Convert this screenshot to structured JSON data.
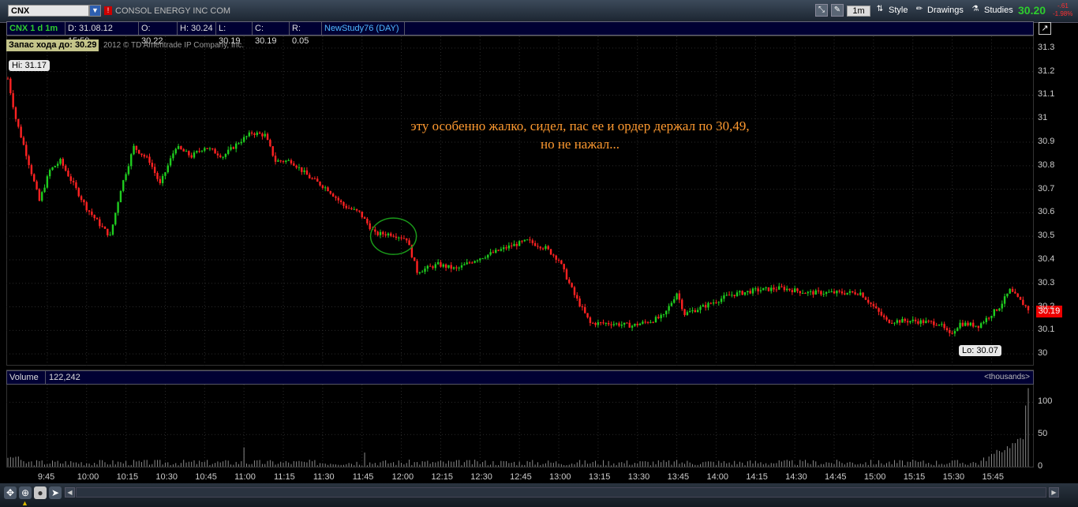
{
  "header": {
    "symbol": "CNX",
    "company_name": "CONSOL ENERGY INC COM",
    "alert_badge": "!",
    "timeframe": "1m",
    "style_label": "Style",
    "drawings_label": "Drawings",
    "studies_label": "Studies",
    "last_price": "30.20",
    "change_abs": "-.61",
    "change_pct": "-1.98%"
  },
  "info_bar": {
    "symbol_period": "CNX 1 d 1m",
    "date": "D: 31.08.12 15:59",
    "open": "O: 30.22",
    "high": "H: 30.24",
    "low": "L: 30.19",
    "close": "C: 30.19",
    "range": "R: 0.05",
    "study": "NewStudy76 (DAY)"
  },
  "overlay": {
    "reserve_label": "Запас хода до: 30.29",
    "copyright": "2012 © TD Ameritrade IP Company, Inc.",
    "hi_label": "Hi: 31.17",
    "lo_label": "Lo: 30.07",
    "current_price_flag": "30.19",
    "annotation_line1": "эту особенно жалко, сидел, пас ее и ордер держал по 30,49,",
    "annotation_line2": "но не нажал..."
  },
  "colors": {
    "up_candle": "#1fcc1f",
    "down_candle": "#ff2222",
    "background": "#000000",
    "annotation": "#ff9a30",
    "circle": "#1a9a1a",
    "last_price": "#2ecc2e"
  },
  "volume_panel": {
    "label": "Volume",
    "value": "122,242",
    "units": "<thousands>",
    "y_ticks": [
      "100",
      "50",
      "0"
    ]
  },
  "price_axis": {
    "ticks": [
      "31.3",
      "31.2",
      "31.1",
      "31",
      "30.9",
      "30.8",
      "30.7",
      "30.6",
      "30.5",
      "30.4",
      "30.3",
      "30.2",
      "30.1",
      "30"
    ]
  },
  "time_axis": {
    "ticks": [
      "9:45",
      "10:00",
      "10:15",
      "10:30",
      "10:45",
      "11:00",
      "11:15",
      "11:30",
      "11:45",
      "12:00",
      "12:15",
      "12:30",
      "12:45",
      "13:00",
      "13:15",
      "13:30",
      "13:45",
      "14:00",
      "14:15",
      "14:30",
      "14:45",
      "15:00",
      "15:15",
      "15:30",
      "15:45"
    ]
  },
  "chart_data": {
    "type": "candlestick",
    "interval": "1m",
    "ylim": [
      29.95,
      31.35
    ],
    "volume_ylim": [
      0,
      125
    ],
    "keypoints": [
      {
        "t": "9:30",
        "price": 31.17
      },
      {
        "t": "9:33",
        "price": 31.0
      },
      {
        "t": "9:37",
        "price": 30.85
      },
      {
        "t": "9:42",
        "price": 30.65
      },
      {
        "t": "9:46",
        "price": 30.78
      },
      {
        "t": "9:50",
        "price": 30.82
      },
      {
        "t": "9:55",
        "price": 30.72
      },
      {
        "t": "10:00",
        "price": 30.62
      },
      {
        "t": "10:05",
        "price": 30.55
      },
      {
        "t": "10:09",
        "price": 30.5
      },
      {
        "t": "10:13",
        "price": 30.7
      },
      {
        "t": "10:18",
        "price": 30.88
      },
      {
        "t": "10:24",
        "price": 30.82
      },
      {
        "t": "10:28",
        "price": 30.72
      },
      {
        "t": "10:34",
        "price": 30.88
      },
      {
        "t": "10:40",
        "price": 30.84
      },
      {
        "t": "10:45",
        "price": 30.88
      },
      {
        "t": "10:52",
        "price": 30.84
      },
      {
        "t": "10:58",
        "price": 30.9
      },
      {
        "t": "11:03",
        "price": 30.94
      },
      {
        "t": "11:08",
        "price": 30.93
      },
      {
        "t": "11:12",
        "price": 30.82
      },
      {
        "t": "11:18",
        "price": 30.82
      },
      {
        "t": "11:25",
        "price": 30.75
      },
      {
        "t": "11:32",
        "price": 30.7
      },
      {
        "t": "11:38",
        "price": 30.63
      },
      {
        "t": "11:44",
        "price": 30.6
      },
      {
        "t": "11:50",
        "price": 30.51
      },
      {
        "t": "11:56",
        "price": 30.51
      },
      {
        "t": "12:02",
        "price": 30.49
      },
      {
        "t": "12:06",
        "price": 30.35
      },
      {
        "t": "12:14",
        "price": 30.38
      },
      {
        "t": "12:21",
        "price": 30.36
      },
      {
        "t": "12:28",
        "price": 30.4
      },
      {
        "t": "12:35",
        "price": 30.43
      },
      {
        "t": "12:42",
        "price": 30.46
      },
      {
        "t": "12:48",
        "price": 30.48
      },
      {
        "t": "12:55",
        "price": 30.45
      },
      {
        "t": "13:00",
        "price": 30.4
      },
      {
        "t": "13:06",
        "price": 30.25
      },
      {
        "t": "13:12",
        "price": 30.13
      },
      {
        "t": "13:20",
        "price": 30.13
      },
      {
        "t": "13:28",
        "price": 30.12
      },
      {
        "t": "13:35",
        "price": 30.14
      },
      {
        "t": "13:40",
        "price": 30.16
      },
      {
        "t": "13:45",
        "price": 30.26
      },
      {
        "t": "13:48",
        "price": 30.17
      },
      {
        "t": "13:55",
        "price": 30.2
      },
      {
        "t": "14:05",
        "price": 30.25
      },
      {
        "t": "14:15",
        "price": 30.27
      },
      {
        "t": "14:25",
        "price": 30.28
      },
      {
        "t": "14:35",
        "price": 30.26
      },
      {
        "t": "14:45",
        "price": 30.26
      },
      {
        "t": "14:55",
        "price": 30.26
      },
      {
        "t": "15:00",
        "price": 30.2
      },
      {
        "t": "15:05",
        "price": 30.14
      },
      {
        "t": "15:15",
        "price": 30.14
      },
      {
        "t": "15:25",
        "price": 30.13
      },
      {
        "t": "15:29",
        "price": 30.08
      },
      {
        "t": "15:33",
        "price": 30.13
      },
      {
        "t": "15:40",
        "price": 30.12
      },
      {
        "t": "15:48",
        "price": 30.2
      },
      {
        "t": "15:52",
        "price": 30.27
      },
      {
        "t": "15:59",
        "price": 30.19
      }
    ]
  }
}
